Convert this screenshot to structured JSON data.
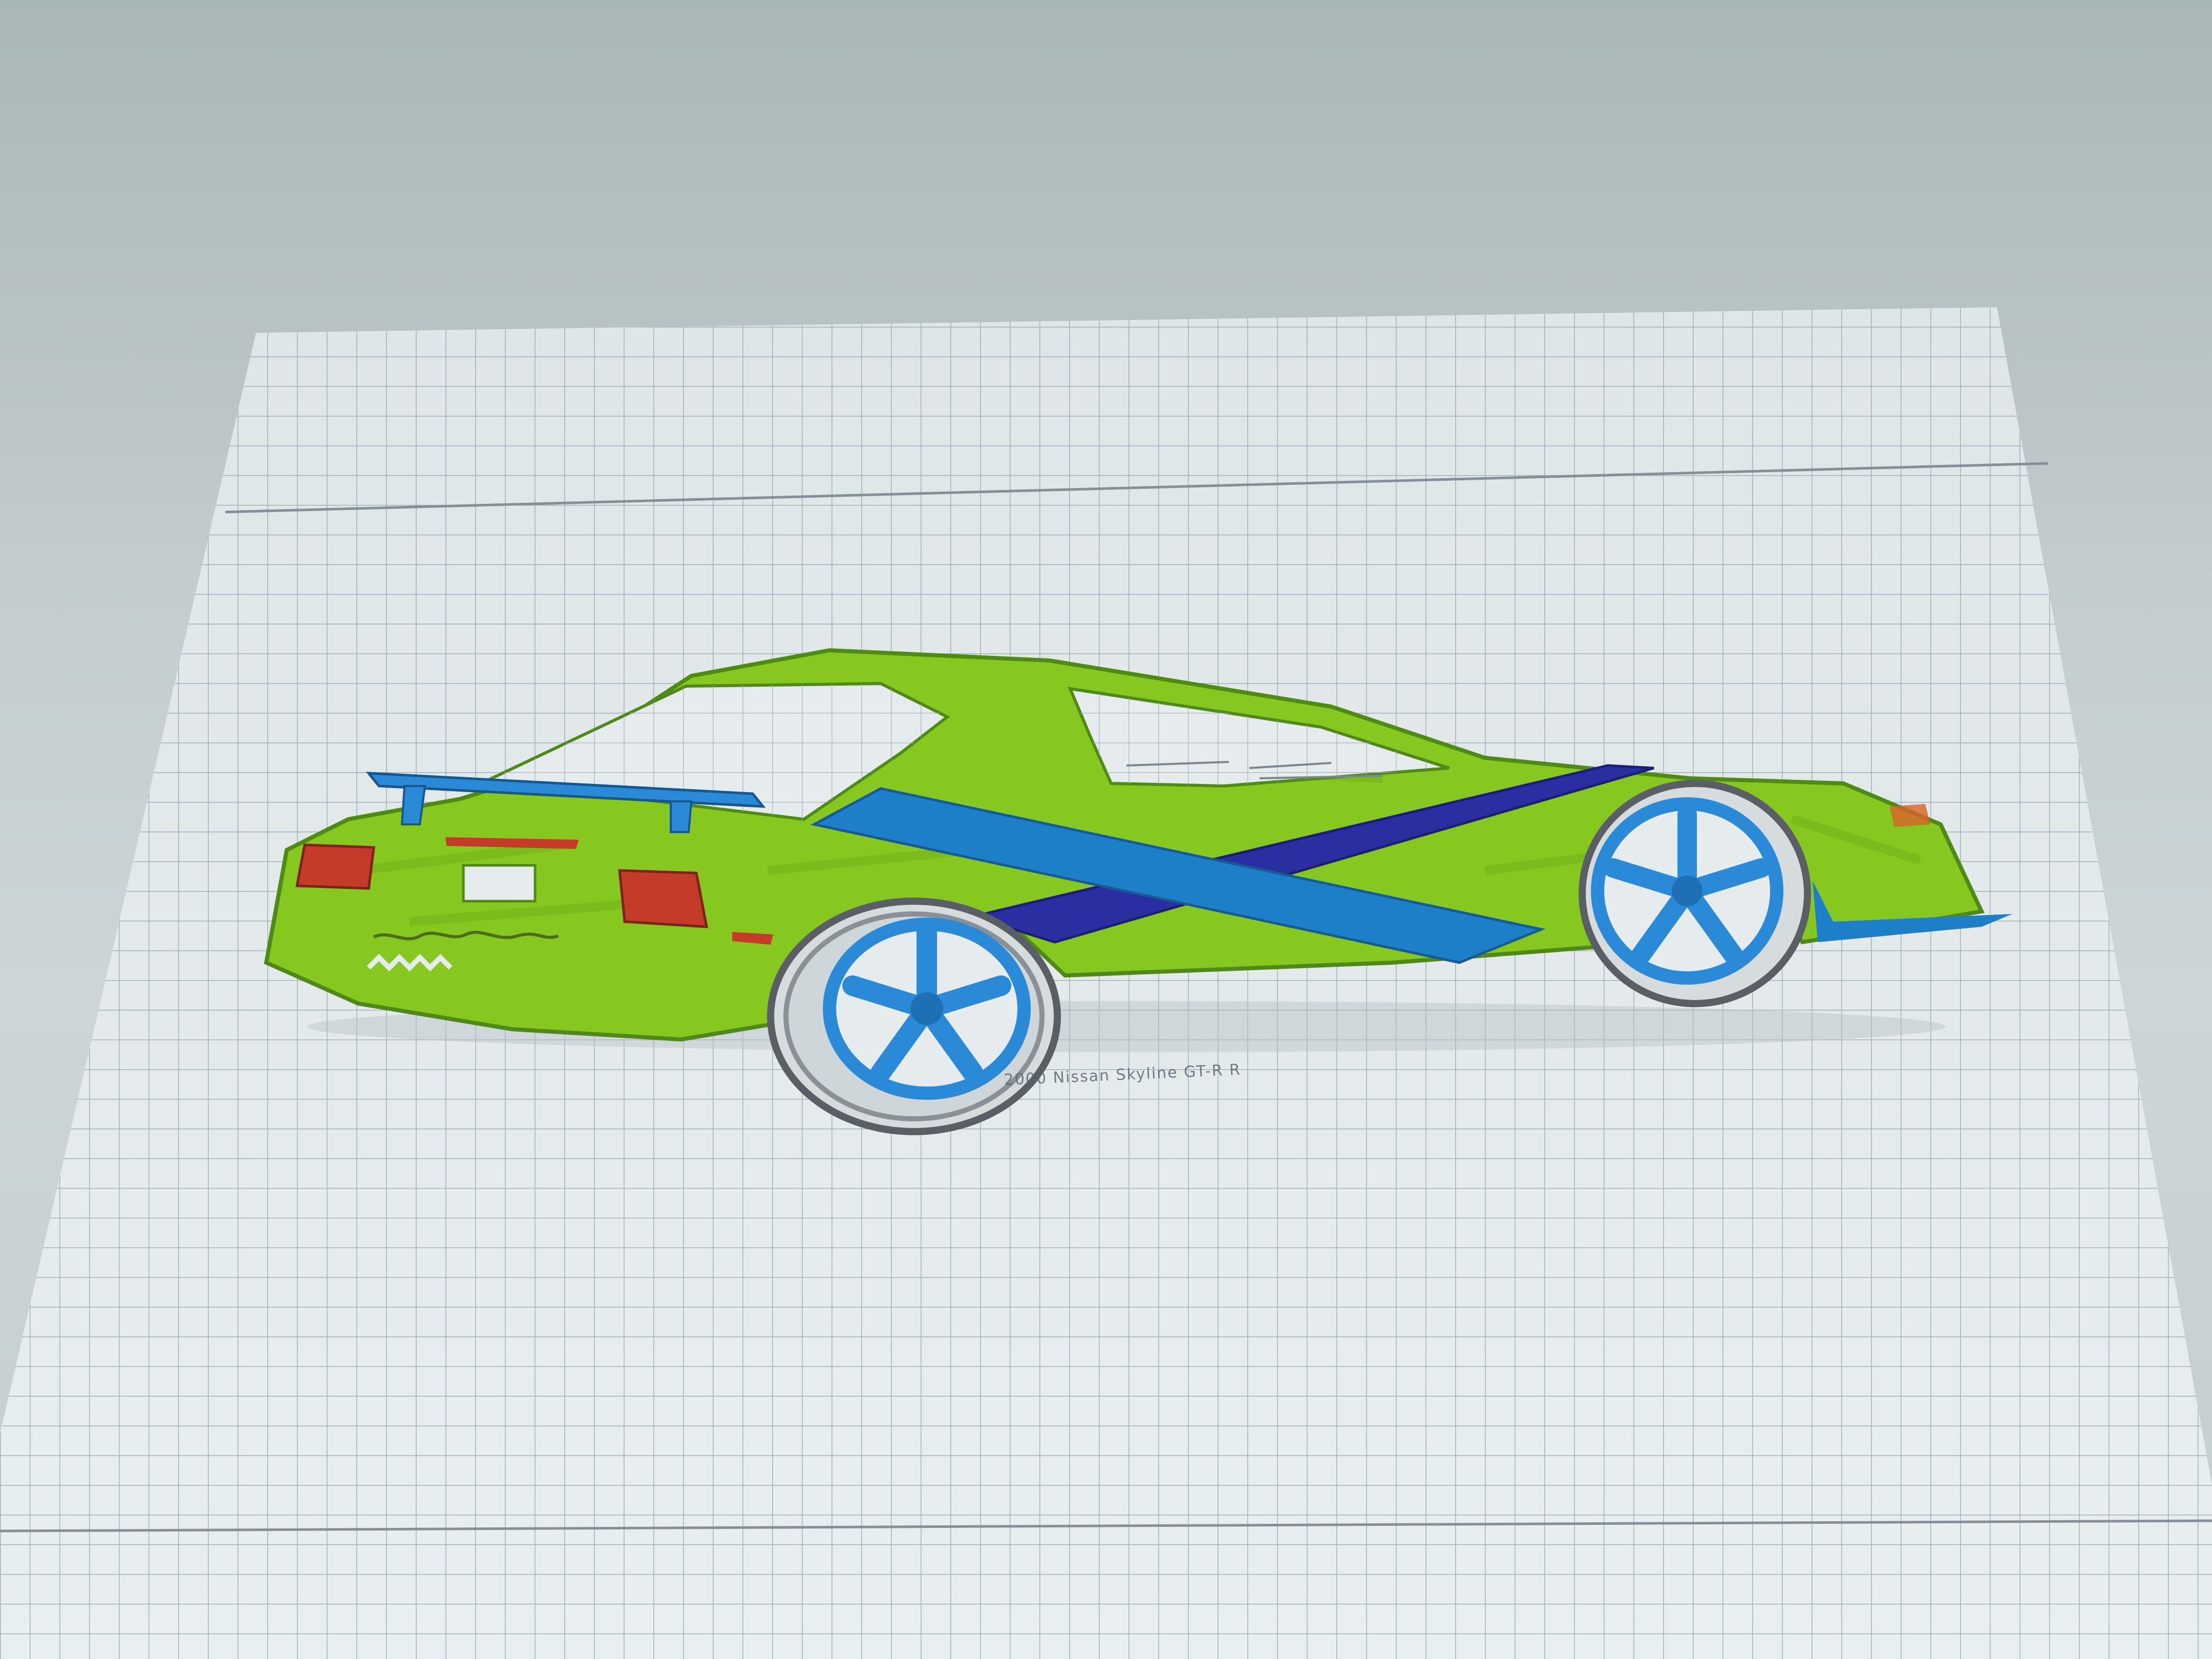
{
  "scene": {
    "subject": "hand-drawn sports car on graph paper",
    "colors": {
      "background": "#c3ccce",
      "paper": "#e6ecee",
      "grid_line": "#9ea9b1",
      "car_body": "#86c820",
      "stripe_light": "#1e7fc9",
      "stripe_dark": "#2a2ea0",
      "wheel_rim": "#2a8ad8",
      "tail_light": "#c43b2a",
      "tire": "#5a5f66"
    }
  },
  "caption": {
    "text": "2000 Nissan Skyline GT-R R"
  }
}
